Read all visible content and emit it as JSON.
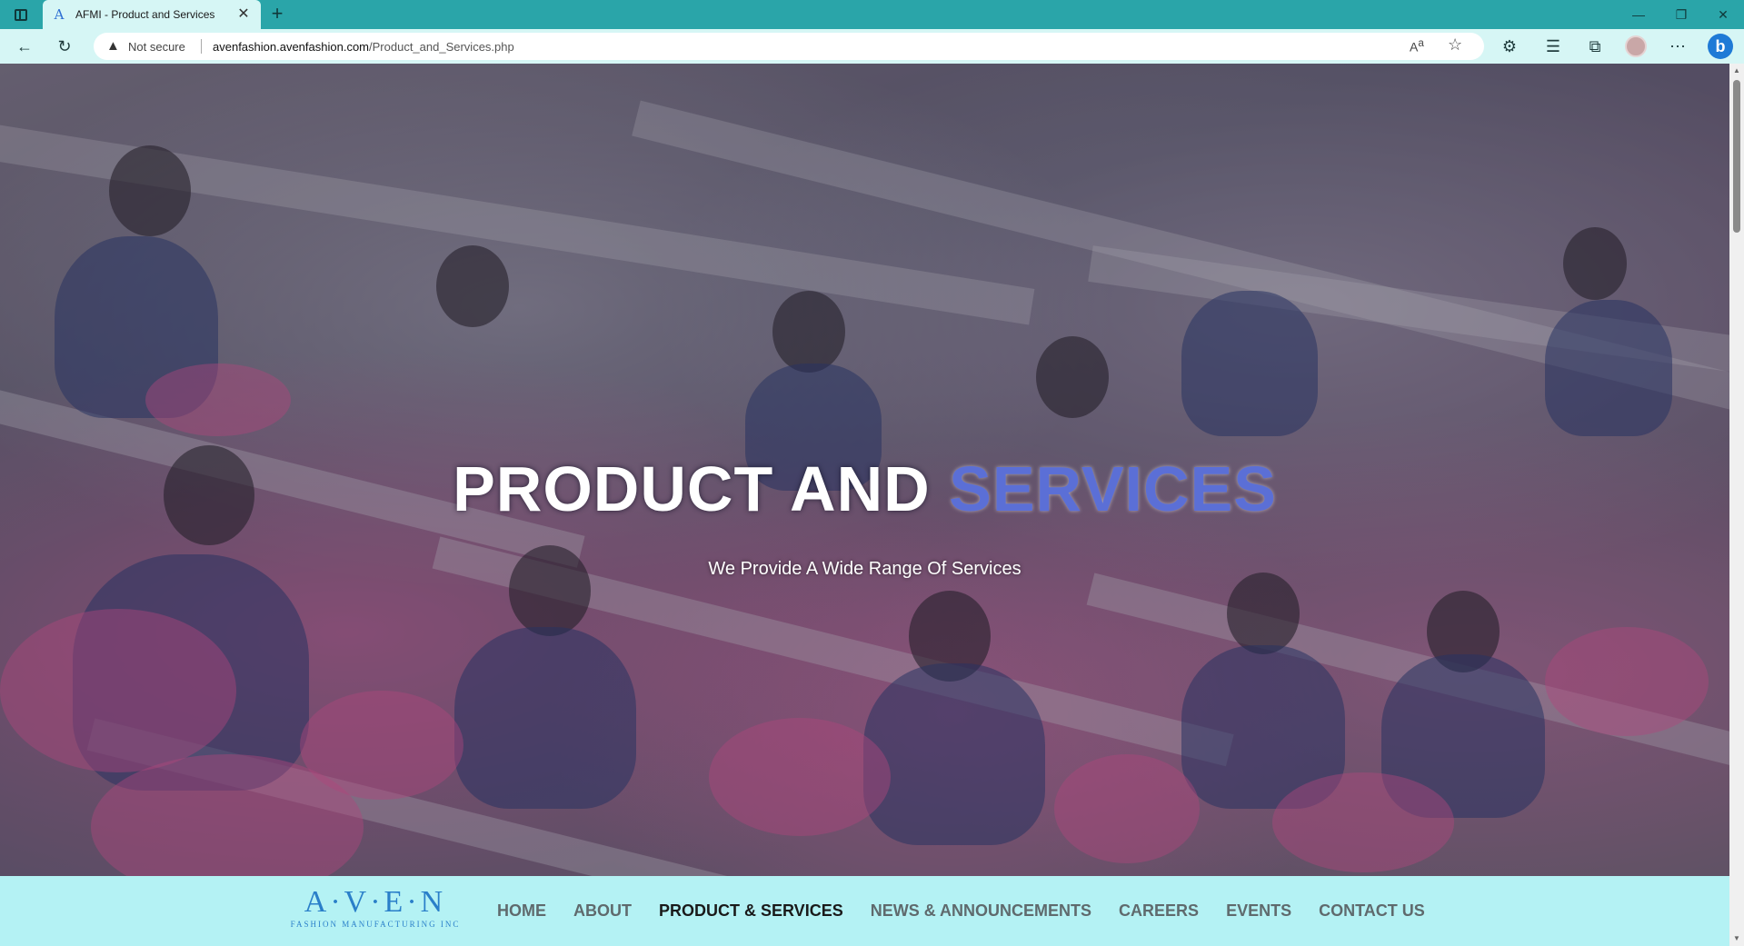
{
  "browser": {
    "tab_title": "AFMI - Product and Services",
    "tab_favicon": "A",
    "security_label": "Not secure",
    "url_domain": "avenfashion.avenfashion.com",
    "url_path": "/Product_and_Services.php",
    "read_aloud_glyph": "Aͅ"
  },
  "hero": {
    "title_white": "PRODUCT AND ",
    "title_blue": "SERVICES",
    "subtitle": "We Provide A Wide Range Of Services"
  },
  "logo": {
    "mark": "A·V·E·N",
    "sub": "FASHION MANUFACTURING INC"
  },
  "nav": {
    "home": "HOME",
    "about": "ABOUT",
    "products": "PRODUCT & SERVICES",
    "news": "NEWS & ANNOUNCEMENTS",
    "careers": "CAREERS",
    "events": "EVENTS",
    "contact": "CONTACT US"
  },
  "colors": {
    "browser_frame": "#2aa5a9",
    "toolbar": "#d6f6f5",
    "nav_background": "#b4f2f4",
    "title_accent": "#5b6fd6",
    "logo": "#2a7fc9"
  }
}
